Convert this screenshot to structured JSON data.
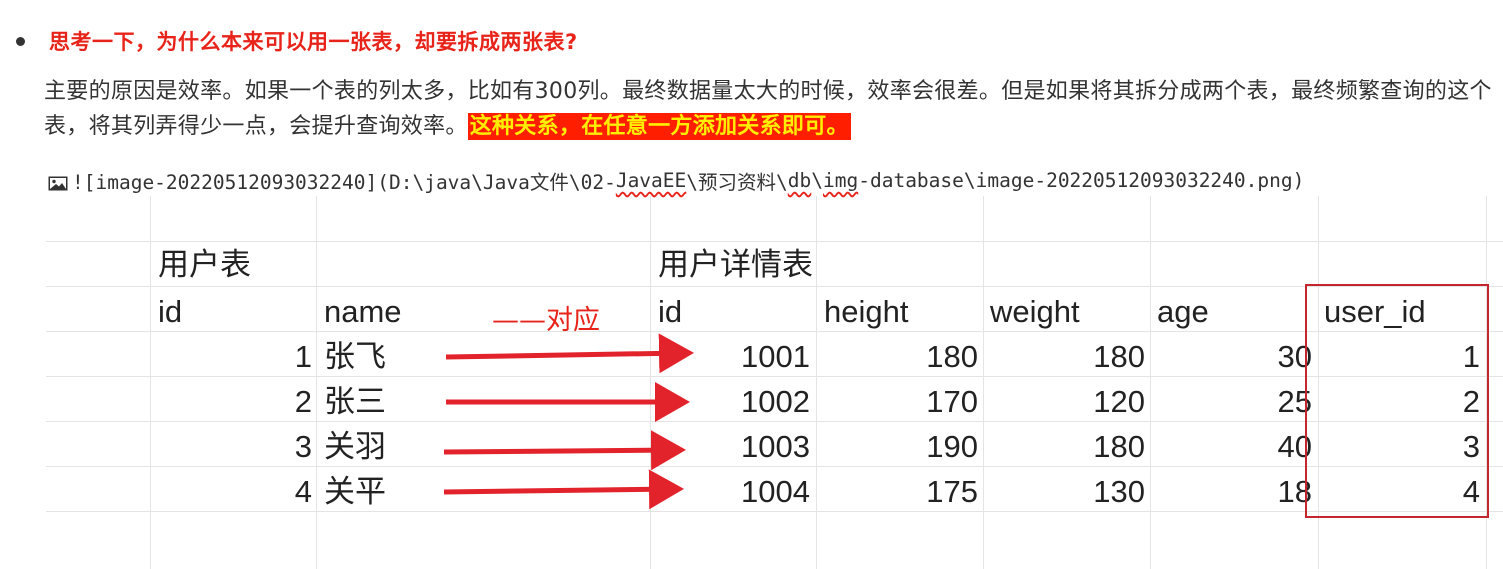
{
  "heading": "思考一下，为什么本来可以用一张表，却要拆成两张表?",
  "paragraph": {
    "text": "主要的原因是效率。如果一个表的列太多，比如有300列。最终数据量太大的时候，效率会很差。但是如果将其拆分成两个表，最终频繁查询的这个表，将其列弄得少一点，会提升查询效率。",
    "highlight": "这种关系，在任意一方添加关系即可。"
  },
  "image_link": {
    "prefix": "![image-20220512093032240](D:\\java\\Java文件\\02-",
    "seg_javaee": "JavaEE",
    "seg_mid": "\\预习资料\\",
    "seg_db": "db",
    "seg_mid2": "\\",
    "seg_img": "img",
    "suffix": "-database\\image-20220512093032240.png)"
  },
  "sheet": {
    "user_table_title": "用户表",
    "detail_table_title": "用户详情表",
    "correspond_label": "——对应",
    "user_headers": [
      "id",
      "name"
    ],
    "detail_headers": [
      "id",
      "height",
      "weight",
      "age",
      "user_id"
    ],
    "user_rows": [
      {
        "id": "1",
        "name": "张飞"
      },
      {
        "id": "2",
        "name": "张三"
      },
      {
        "id": "3",
        "name": "关羽"
      },
      {
        "id": "4",
        "name": "关平"
      }
    ],
    "detail_rows": [
      {
        "id": "1001",
        "height": "180",
        "weight": "180",
        "age": "30",
        "user_id": "1"
      },
      {
        "id": "1002",
        "height": "170",
        "weight": "120",
        "age": "25",
        "user_id": "2"
      },
      {
        "id": "1003",
        "height": "190",
        "weight": "180",
        "age": "40",
        "user_id": "3"
      },
      {
        "id": "1004",
        "height": "175",
        "weight": "130",
        "age": "18",
        "user_id": "4"
      }
    ]
  },
  "colors": {
    "accent_red": "#e8241a",
    "highlight_bg": "#ff1e00",
    "highlight_fg": "#ffee00"
  }
}
